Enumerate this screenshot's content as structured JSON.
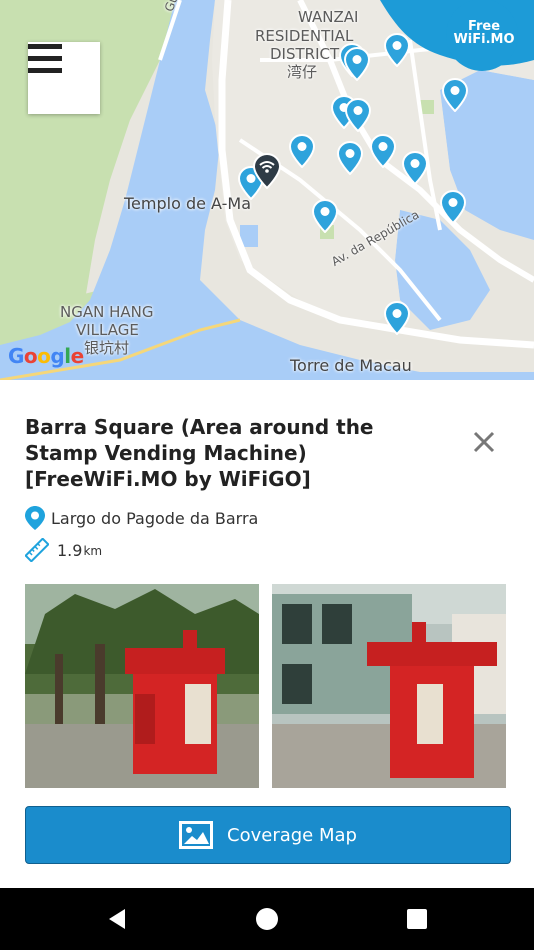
{
  "map": {
    "labels": {
      "district_1": "WANZAI",
      "district_2": "RESIDENTIAL",
      "district_3": "DISTRICT",
      "district_cn": "湾仔",
      "temple": "Templo de A-Ma",
      "village_1": "NGAN HANG",
      "village_2": "VILLAGE",
      "village_cn": "银坑村",
      "tower": "Torre de Macau",
      "street_1": "Guiyu",
      "street_2": "Av. da República"
    },
    "attribution": "Google",
    "logo_text_1": "Free",
    "logo_text_2": "WiFi.MO",
    "colors": {
      "water": "#a9cdf7",
      "land": "#e8e6df",
      "green": "#c8e0b0",
      "pin": "#2ea3dc",
      "road": "#ffffff"
    }
  },
  "detail": {
    "title": "Barra Square (Area around the Stamp Vending Machine) [FreeWiFi.MO by WiFiGO]",
    "address": "Largo do Pagode da Barra",
    "distance_value": "1.9",
    "distance_unit": "km"
  },
  "coverage_button": {
    "label": "Coverage Map",
    "color": "#1a8ccc"
  }
}
